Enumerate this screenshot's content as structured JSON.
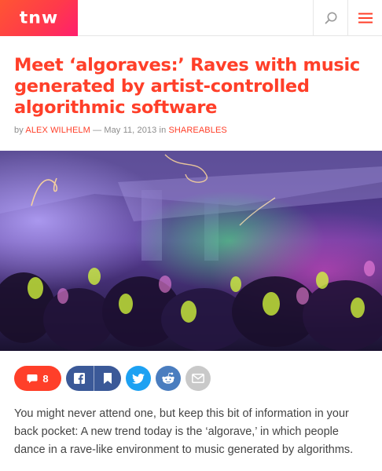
{
  "header": {
    "logo_text": "TNW",
    "brand_color": "#ff3f29",
    "search_icon": "search-icon",
    "menu_icon": "hamburger-menu-icon"
  },
  "article": {
    "title": "Meet ‘algoraves:’ Raves with music generated by artist-controlled algorithmic software",
    "byline": {
      "prefix": "by",
      "author": "ALEX WILHELM",
      "separator": "—",
      "date": "May 11, 2013",
      "in_word": "in",
      "category": "SHAREABLES"
    },
    "hero_alt": "Crowd at a rave under purple and green lights"
  },
  "share": {
    "comment_count": "8",
    "facebook_icon": "facebook-icon",
    "bookmark_icon": "bookmark-icon",
    "twitter_icon": "twitter-icon",
    "reddit_icon": "reddit-icon",
    "mail_icon": "mail-icon"
  },
  "body": {
    "paragraph": "You might never attend one, but keep this bit of information in your back pocket: A new trend today is the ‘algorave,’ in which people dance in a rave-like environment to music generated by algorithms."
  }
}
